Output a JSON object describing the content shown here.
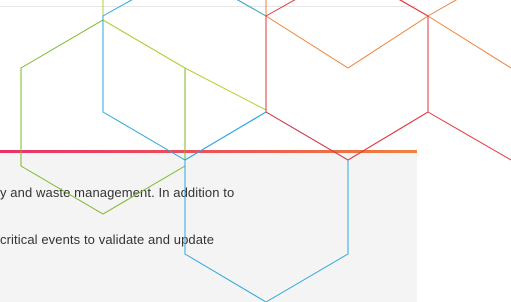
{
  "body_text": {
    "line_1": "y and waste management. In addition to",
    "line_2": "critical events to validate and update"
  },
  "colors": {
    "panel_background": "#f4f4f4",
    "text": "#333333",
    "hex_green": "#7ab929",
    "hex_lime": "#b7d23a",
    "hex_blue": "#2ea7dd",
    "hex_orange": "#f0823c",
    "hex_red": "#e2363f",
    "accent_bar_gradient": [
      "#e9316a",
      "#f0823c"
    ]
  },
  "decoration": {
    "pattern_icon": "hexagon-outline-pattern"
  }
}
